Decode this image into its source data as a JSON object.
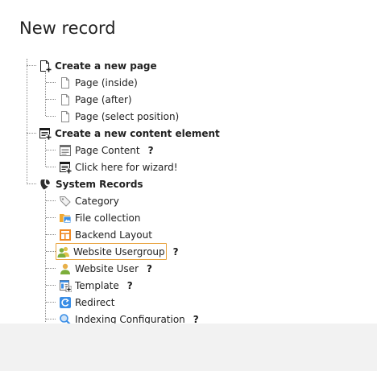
{
  "page": {
    "title": "New record"
  },
  "tree": {
    "create_page": {
      "label": "Create a new page",
      "icon": "page-new-icon",
      "children": [
        {
          "label": "Page (inside)",
          "icon": "page-icon"
        },
        {
          "label": "Page (after)",
          "icon": "page-icon"
        },
        {
          "label": "Page (select position)",
          "icon": "page-icon"
        }
      ]
    },
    "create_content": {
      "label": "Create a new content element",
      "icon": "content-new-icon",
      "children": [
        {
          "label": "Page Content",
          "icon": "content-icon",
          "help": "?"
        },
        {
          "label": "Click here for wizard!",
          "icon": "content-wizard-icon"
        }
      ]
    },
    "system_records": {
      "label": "System Records",
      "icon": "typo3-logo-icon",
      "children": [
        {
          "label": "Category",
          "icon": "category-tag-icon"
        },
        {
          "label": "File collection",
          "icon": "file-collection-icon"
        },
        {
          "label": "Backend Layout",
          "icon": "backend-layout-icon"
        },
        {
          "label": "Website Usergroup",
          "icon": "usergroup-icon",
          "help": "?",
          "focused": true
        },
        {
          "label": "Website User",
          "icon": "user-icon",
          "help": "?"
        },
        {
          "label": "Template",
          "icon": "template-icon",
          "help": "?"
        },
        {
          "label": "Redirect",
          "icon": "redirect-icon"
        },
        {
          "label": "Indexing Configuration",
          "icon": "indexing-search-icon",
          "help": "?"
        }
      ]
    }
  },
  "colors": {
    "focus_border": "#e8a33d",
    "footer_background": "#f2f2f2",
    "redirect_blue": "#3a8ee6",
    "layout_orange": "#f08a24",
    "user_green": "#7cae3a"
  }
}
